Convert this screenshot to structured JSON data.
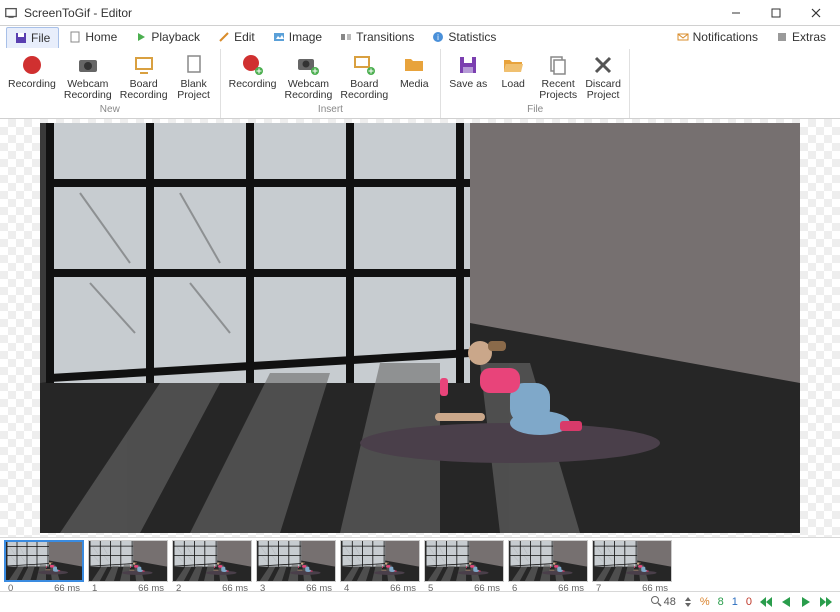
{
  "window": {
    "title": "ScreenToGif - Editor"
  },
  "tabs": {
    "file": "File",
    "home": "Home",
    "playback": "Playback",
    "edit": "Edit",
    "image": "Image",
    "transitions": "Transitions",
    "statistics": "Statistics",
    "notifications": "Notifications",
    "extras": "Extras"
  },
  "ribbon": {
    "groups": {
      "new": {
        "label": "New",
        "recording": "Recording",
        "webcam": "Webcam\nRecording",
        "board": "Board\nRecording",
        "blank": "Blank\nProject"
      },
      "insert": {
        "label": "Insert",
        "recording": "Recording",
        "webcam": "Webcam\nRecording",
        "board": "Board\nRecording",
        "media": "Media"
      },
      "file": {
        "label": "File",
        "saveas": "Save as",
        "load": "Load",
        "recent": "Recent\nProjects",
        "discard": "Discard\nProject"
      }
    }
  },
  "frames": [
    {
      "index": 0,
      "delay": "66 ms"
    },
    {
      "index": 1,
      "delay": "66 ms"
    },
    {
      "index": 2,
      "delay": "66 ms"
    },
    {
      "index": 3,
      "delay": "66 ms"
    },
    {
      "index": 4,
      "delay": "66 ms"
    },
    {
      "index": 5,
      "delay": "66 ms"
    },
    {
      "index": 6,
      "delay": "66 ms"
    },
    {
      "index": 7,
      "delay": "66 ms"
    }
  ],
  "status": {
    "zoom": "48",
    "frames": "8",
    "selected": "1",
    "clipboard": "0"
  }
}
